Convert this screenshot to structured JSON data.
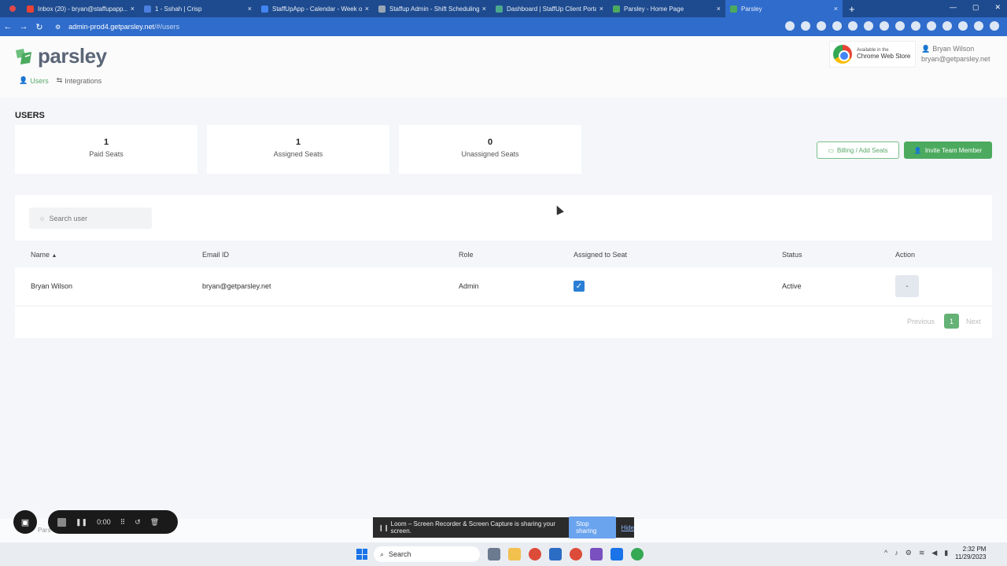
{
  "browser": {
    "tabs": [
      {
        "label": "Inbox (20) - bryan@staffupapp...",
        "color": "#ea4335"
      },
      {
        "label": "1 - Sshah | Crisp",
        "color": "#4a7fe0"
      },
      {
        "label": "StaffUpApp - Calendar - Week o...",
        "color": "#4285f4"
      },
      {
        "label": "Staffup Admin - Shift Scheduling",
        "color": "#9aa6b6"
      },
      {
        "label": "Dashboard | StaffUp Client Porta...",
        "color": "#4caa8c"
      },
      {
        "label": "Parsley - Home Page",
        "color": "#4caa5f"
      },
      {
        "label": "Parsley",
        "color": "#4caa5f",
        "active": true
      }
    ],
    "close_glyph": "×",
    "new_tab": "+",
    "url_host": "admin-prod4.getparsley.net",
    "url_path": "/#/users"
  },
  "header": {
    "logo_text": "parsley",
    "nav": [
      {
        "label": "Users",
        "icon": "user-icon",
        "active": true
      },
      {
        "label": "Integrations",
        "icon": "swap-icon",
        "active": false
      }
    ],
    "cws_small": "Available in the",
    "cws_big": "Chrome Web Store",
    "user_name": "Bryan Wilson",
    "user_email": "bryan@getparsley.net"
  },
  "page": {
    "title": "USERS",
    "stats": [
      {
        "value": "1",
        "label": "Paid Seats"
      },
      {
        "value": "1",
        "label": "Assigned Seats"
      },
      {
        "value": "0",
        "label": "Unassigned Seats"
      }
    ],
    "billing_button": "Billing / Add Seats",
    "invite_button": "Invite Team Member",
    "search_placeholder": "Search user"
  },
  "table": {
    "headers": {
      "name": "Name",
      "email": "Email ID",
      "role": "Role",
      "seat": "Assigned to Seat",
      "status": "Status",
      "action": "Action"
    },
    "rows": [
      {
        "name": "Bryan Wilson",
        "email": "bryan@getparsley.net",
        "role": "Admin",
        "assigned": true,
        "status": "Active",
        "action": "-"
      }
    ],
    "pager": {
      "previous": "Previous",
      "page": "1",
      "next": "Next"
    }
  },
  "footer_text": "Pars",
  "loom": {
    "timer": "0:00",
    "share_message": "Loom – Screen Recorder & Screen Capture is sharing your screen.",
    "stop_sharing": "Stop sharing",
    "hide": "Hide"
  },
  "taskbar": {
    "search": "Search",
    "time": "2:32 PM",
    "date": "11/29/2023"
  },
  "colors": {
    "accent": "#4caa5f",
    "browser": "#2f6ccb",
    "checkbox": "#2a7fd4"
  }
}
